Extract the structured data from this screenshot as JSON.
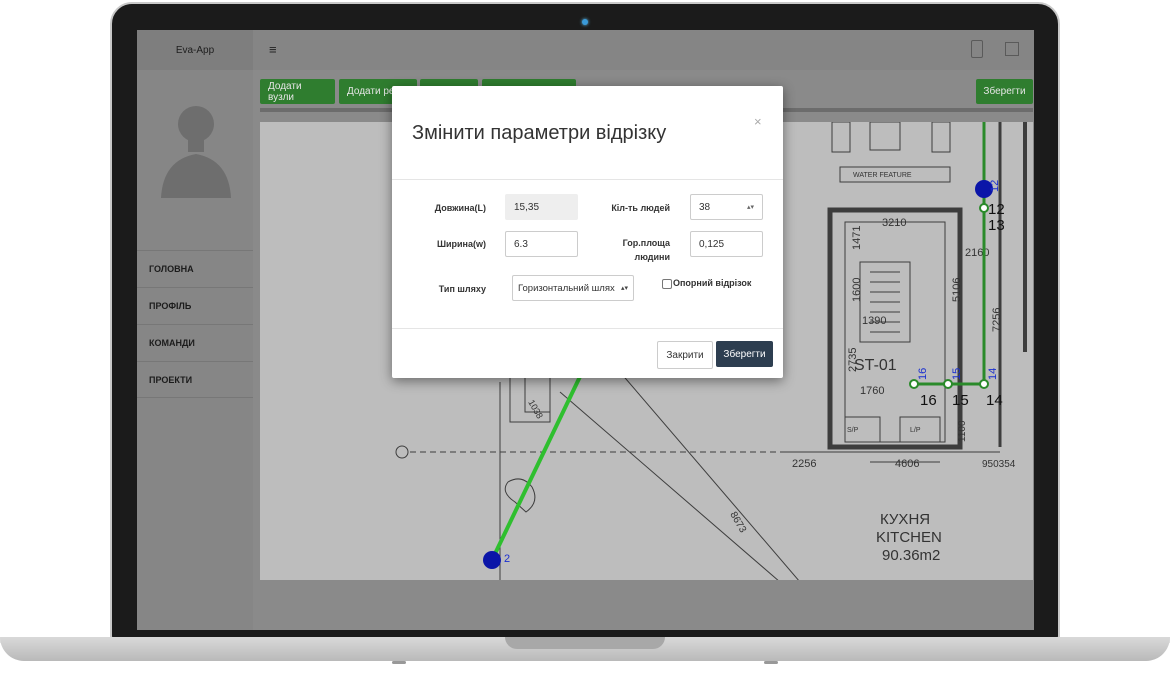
{
  "app": {
    "brand": "Eva-App",
    "menu_icon": "≡"
  },
  "nav": {
    "items": [
      {
        "label": "ГОЛОВНА"
      },
      {
        "label": "ПРОФІЛЬ"
      },
      {
        "label": "КОМАНДИ"
      },
      {
        "label": "ПРОЕКТИ"
      }
    ]
  },
  "toolbar": {
    "add_nodes": "Додати вузли",
    "add_segments": "Додати ре",
    "save": "Зберегти"
  },
  "plan": {
    "labels": [
      "3210",
      "1471",
      "1390",
      "1600",
      "5106",
      "2735",
      "1760",
      "2160",
      "7256",
      "2256",
      "4606",
      "950354",
      "1100",
      "8673",
      "1038"
    ],
    "room_name_ua": "КУХНЯ",
    "room_name_en": "KITCHEN",
    "room_area": "90.36m2",
    "stair_label": "ST-01",
    "water_feature": "WATER FEATURE",
    "nodes": [
      "12",
      "13",
      "16",
      "15",
      "14"
    ],
    "node_blue_labels": [
      "12",
      "16",
      "15",
      "14"
    ],
    "node_start": "2",
    "markers": [
      "S/P",
      "L/P"
    ]
  },
  "modal": {
    "title": "Змінити параметри відрізку",
    "close_glyph": "×",
    "length_label": "Довжина(L)",
    "length_value": "15,35",
    "people_label": "Кіл-ть людей",
    "people_value": "38",
    "width_label": "Ширина(w)",
    "width_value": "6.3",
    "area_label_1": "Гор.площа",
    "area_label_2": "людини",
    "area_value": "0,125",
    "path_type_label": "Тип шляху",
    "path_type_value": "Горизонтальний шлях",
    "reference_label": "Опорний відрізок",
    "close_button": "Закрити",
    "save_button": "Зберегти"
  }
}
